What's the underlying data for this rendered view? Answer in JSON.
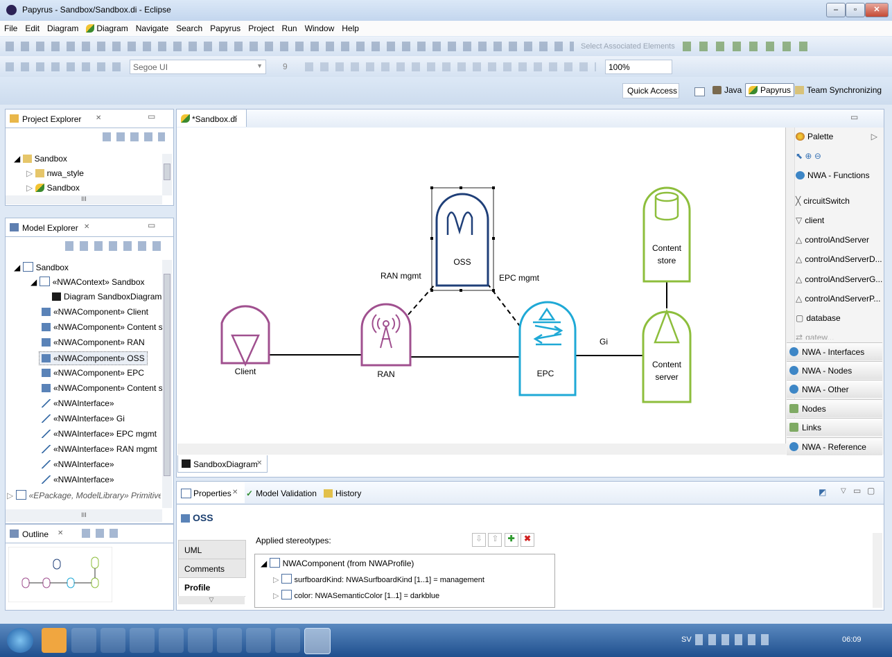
{
  "window": {
    "title": "Papyrus - Sandbox/Sandbox.di - Eclipse"
  },
  "menu": [
    "File",
    "Edit",
    "Diagram",
    "Diagram",
    "Navigate",
    "Search",
    "Papyrus",
    "Project",
    "Run",
    "Window",
    "Help"
  ],
  "toolbar": {
    "select_associated": "Select Associated Elements",
    "font_name": "Segoe UI",
    "font_size": "9",
    "zoom": "100%",
    "quick_access": "Quick Access",
    "perspectives": [
      "Java",
      "Papyrus",
      "Team Synchronizing"
    ]
  },
  "project_explorer": {
    "title": "Project Explorer",
    "items": [
      "Sandbox",
      "nwa_style",
      "Sandbox"
    ],
    "scroll_mark": "III"
  },
  "model_explorer": {
    "title": "Model Explorer",
    "items": [
      "Sandbox",
      "«NWAContext» Sandbox",
      "Diagram SandboxDiagram",
      "«NWAComponent» Client",
      "«NWAComponent» Content sto",
      "«NWAComponent» RAN",
      "«NWAComponent» OSS",
      "«NWAComponent» EPC",
      "«NWAComponent» Content ser",
      "«NWAInterface»",
      "«NWAInterface» Gi",
      "«NWAInterface» EPC mgmt",
      "«NWAInterface» RAN mgmt",
      "«NWAInterface»",
      "«NWAInterface»",
      "«EPackage, ModelLibrary» Primitive"
    ],
    "scroll_mark": "III"
  },
  "outline": {
    "title": "Outline"
  },
  "editor": {
    "tab": "*Sandbox.di",
    "diagram_tab": "SandboxDiagram"
  },
  "diagram": {
    "nodes": {
      "client": "Client",
      "ran": "RAN",
      "oss": "OSS",
      "epc": "EPC",
      "content_store_1": "Content",
      "content_store_2": "store",
      "content_server_1": "Content",
      "content_server_2": "server"
    },
    "links": {
      "ran_mgmt": "RAN mgmt",
      "epc_mgmt": "EPC mgmt",
      "gi": "Gi"
    },
    "colors": {
      "client": "#a0508f",
      "ran": "#a0508f",
      "oss": "#1f3f78",
      "epc": "#1fa9d6",
      "content": "#8dbe3c"
    }
  },
  "palette": {
    "title": "Palette",
    "open_drawer": "NWA - Functions",
    "tools": [
      "circuitSwitch",
      "client",
      "controlAndServer",
      "controlAndServerD...",
      "controlAndServerG...",
      "controlAndServerP...",
      "database",
      "gatew..."
    ],
    "drawers": [
      "NWA - Interfaces",
      "NWA - Nodes",
      "NWA - Other",
      "Nodes",
      "Links",
      "NWA - Reference"
    ]
  },
  "properties": {
    "tabs": [
      "Properties",
      "Model Validation",
      "History"
    ],
    "element": "OSS",
    "side_tabs": [
      "UML",
      "Comments",
      "Profile"
    ],
    "applied_label": "Applied stereotypes:",
    "stereotype": "NWAComponent  (from NWAProfile)",
    "attributes": [
      "surfboardKind: NWASurfboardKind [1..1] = management",
      "color: NWASemanticColor [1..1] = darkblue"
    ]
  },
  "taskbar": {
    "lang": "SV",
    "time": "06:09"
  }
}
